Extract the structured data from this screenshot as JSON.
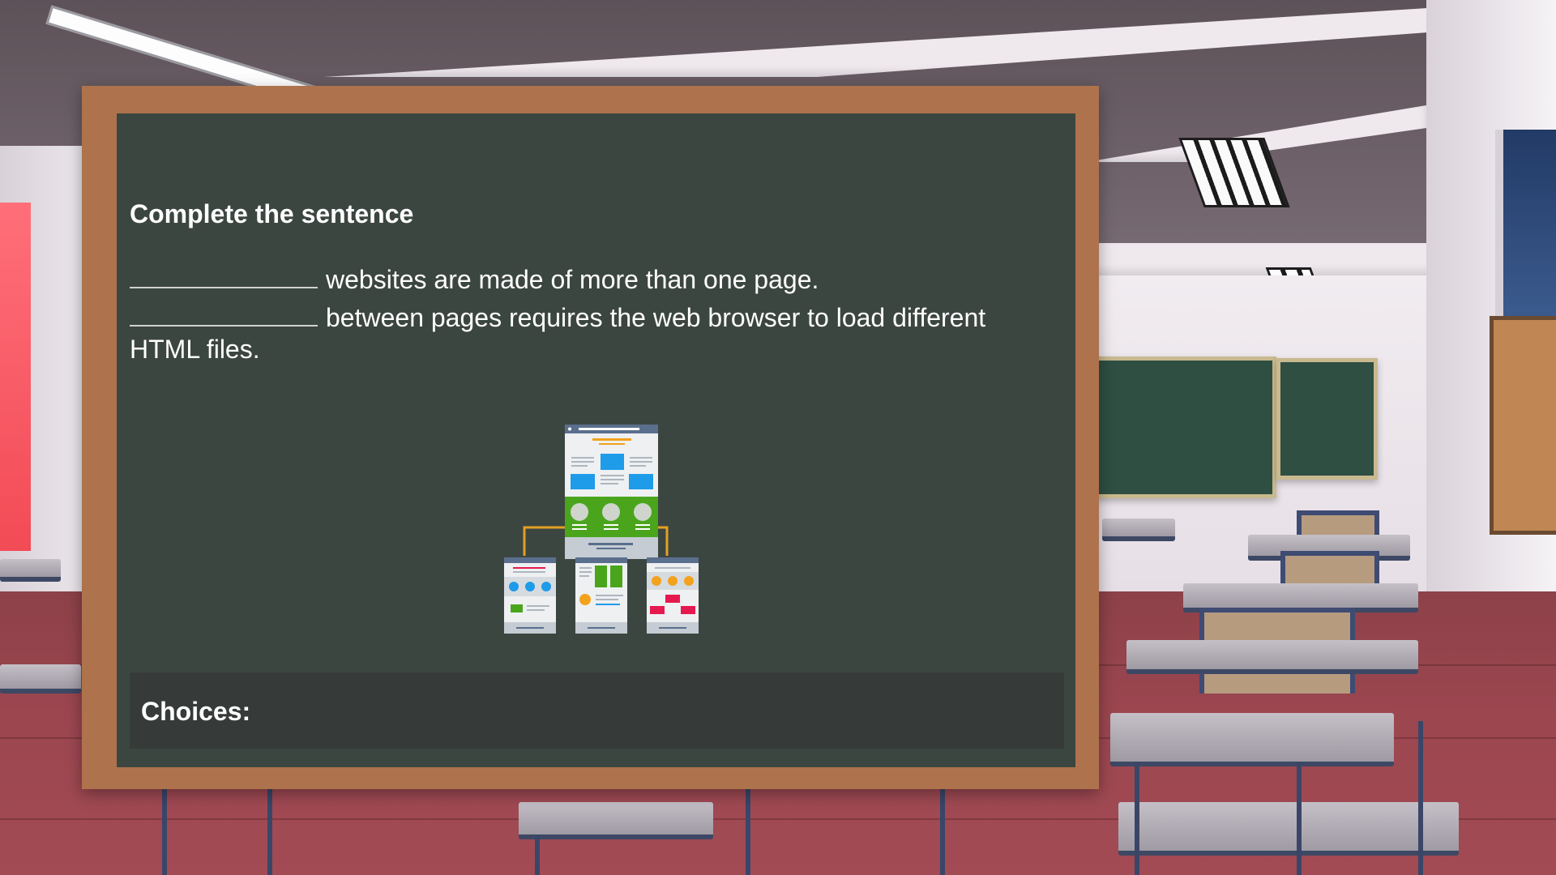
{
  "question": {
    "title": "Complete the sentence",
    "sentence_1_text": "websites are made of more than one page.",
    "sentence_2_text": "between pages requires the web browser to load different HTML files."
  },
  "choices": {
    "label": "Choices:"
  },
  "illustration": {
    "icon": "website-sitemap-icon",
    "colors": {
      "header": "#5a6f8d",
      "accent_blue": "#1e9be9",
      "accent_green": "#4aa51c",
      "accent_orange": "#f2a21c",
      "accent_pink": "#e5194e",
      "connector": "#e2a023"
    }
  },
  "theme": {
    "frame_color": "#ae734c",
    "board_color": "#3c4641",
    "choices_bar_color": "#363b39"
  }
}
